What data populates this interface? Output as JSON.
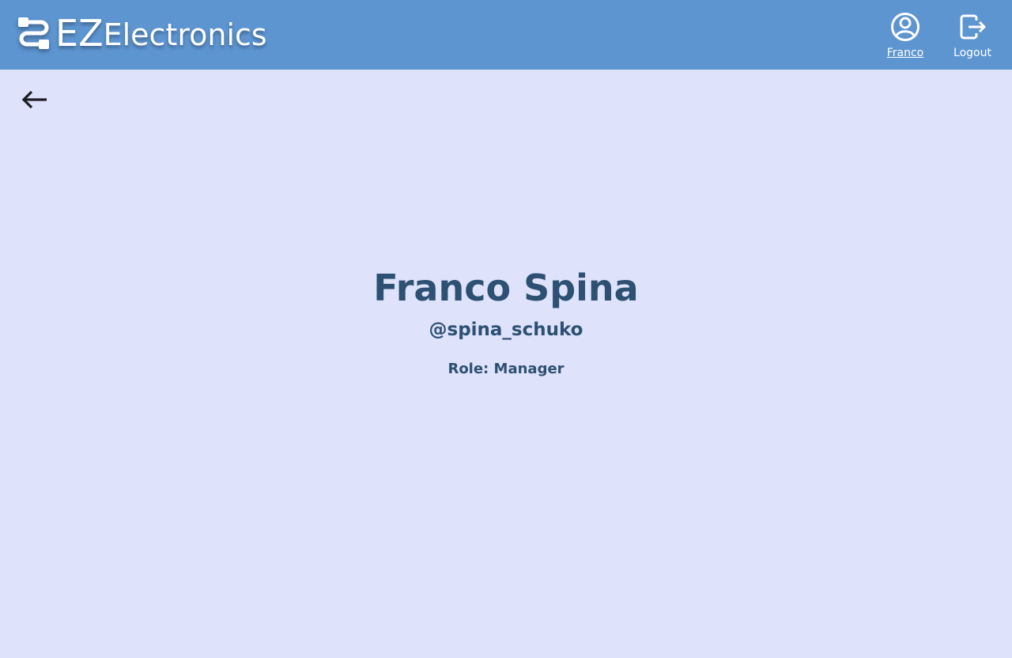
{
  "header": {
    "brand": {
      "prefix": "EZ",
      "name": "Electronics",
      "icon": "cable-icon"
    },
    "nav": {
      "user_label": "Franco",
      "user_icon": "account-circle-icon",
      "logout_label": "Logout",
      "logout_icon": "logout-icon"
    },
    "color": "#5d95d1"
  },
  "back": {
    "icon": "arrow-left-icon"
  },
  "profile": {
    "full_name": "Franco Spina",
    "username": "@spina_schuko",
    "role_label": "Role:",
    "role": "Manager"
  },
  "colors": {
    "background": "#dee2fb",
    "text": "#2d5073"
  }
}
